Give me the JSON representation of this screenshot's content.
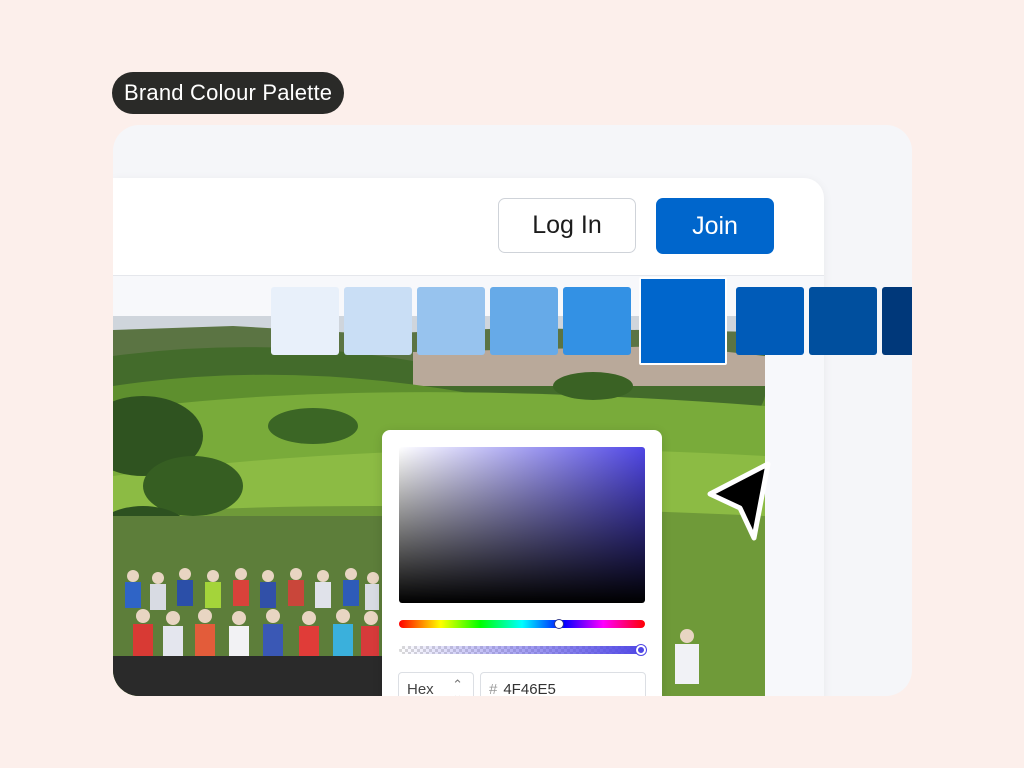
{
  "label": {
    "title": "Brand Colour Palette"
  },
  "header": {
    "login_label": "Log In",
    "join_label": "Join"
  },
  "palette": {
    "swatches": [
      "#e8f0fa",
      "#c9def5",
      "#97c3ee",
      "#66aae8",
      "#3391e4",
      "#0066cc",
      "#005bb8",
      "#004f9e",
      "#00387a"
    ],
    "selected_index": 5
  },
  "color_picker": {
    "format": "Hex",
    "hash_symbol": "#",
    "hex_value": "4F46E5",
    "current_color": "#4f46e5",
    "alpha": 1.0
  },
  "colors": {
    "accent": "#0066cc",
    "background": "#fcefeb"
  }
}
